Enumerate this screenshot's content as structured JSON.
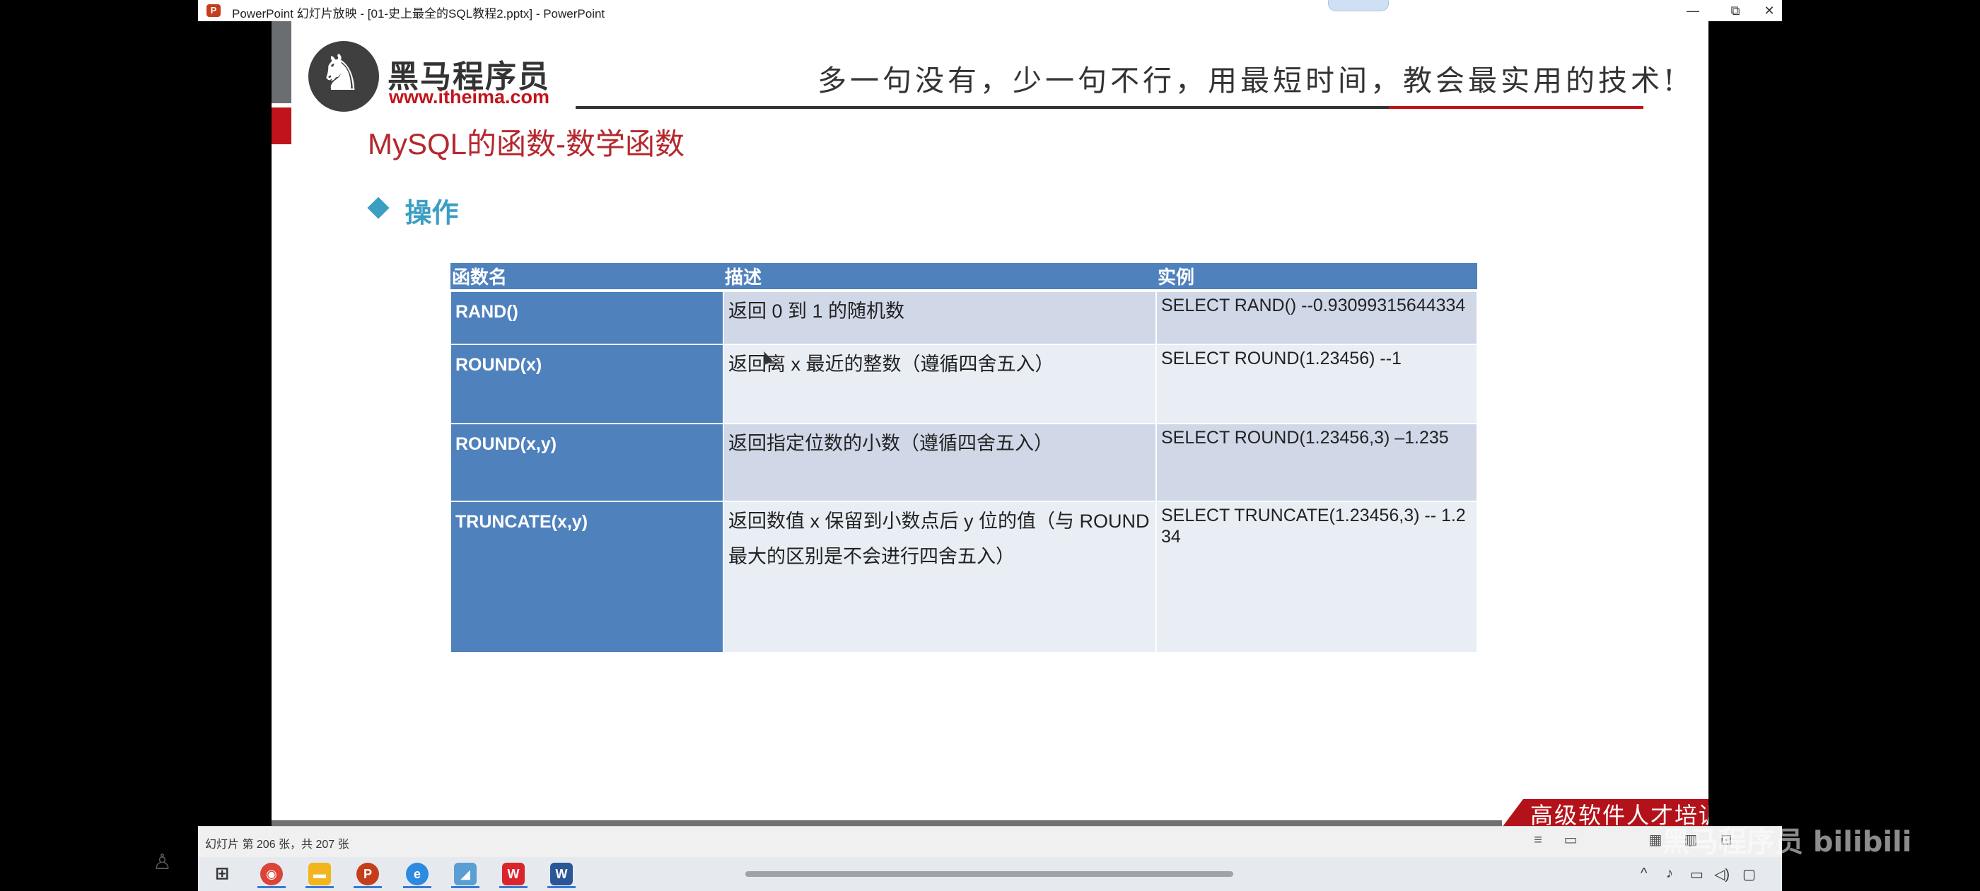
{
  "window": {
    "title": "PowerPoint 幻灯片放映 - [01-史上最全的SQL教程2.pptx] - PowerPoint",
    "app_icon": "P"
  },
  "window_controls": {
    "minimize": "—",
    "restore": "⧉",
    "close": "✕"
  },
  "slide": {
    "logo_name": "黑马程序员",
    "logo_url": "www.itheima.com",
    "slogan": "多一句没有，少一句不行，用最短时间，教会最实用的技术!",
    "title": "MySQL的函数-数学函数",
    "bullet": "操作",
    "footer_tag": "高级软件人才培训专家",
    "colors": {
      "brand_red": "#c0141c",
      "title_red": "#b4282e",
      "table_blue": "#4f81bd",
      "bullet_blue": "#3b9ec2"
    }
  },
  "table": {
    "headers": [
      "函数名",
      "描述",
      "实例"
    ],
    "rows": [
      {
        "name": "RAND()",
        "desc": "返回 0 到 1 的随机数",
        "example": "SELECT RAND() --0.93099315644334"
      },
      {
        "name": "ROUND(x)",
        "desc": "返回离 x 最近的整数（遵循四舍五入）",
        "example": "SELECT ROUND(1.23456) --1"
      },
      {
        "name": "ROUND(x,y)",
        "desc": "返回指定位数的小数（遵循四舍五入）",
        "example": "SELECT ROUND(1.23456,3) –1.235"
      },
      {
        "name": "TRUNCATE(x,y)",
        "desc": "返回数值 x 保留到小数点后 y 位的值（与 ROUND 最大的区别是不会进行四舍五入）",
        "example": "SELECT TRUNCATE(1.23456,3) -- 1.234"
      }
    ]
  },
  "statusbar": {
    "slide_info": "幻灯片 第 206 张，共 207 张"
  },
  "taskbar": {
    "apps": [
      "start-icon",
      "chrome-icon",
      "file-explorer-icon",
      "powerpoint-icon",
      "browser-icon",
      "app-icon",
      "wps-icon",
      "word-icon"
    ]
  },
  "watermark": {
    "text": "黑马程序员 bilibili"
  }
}
